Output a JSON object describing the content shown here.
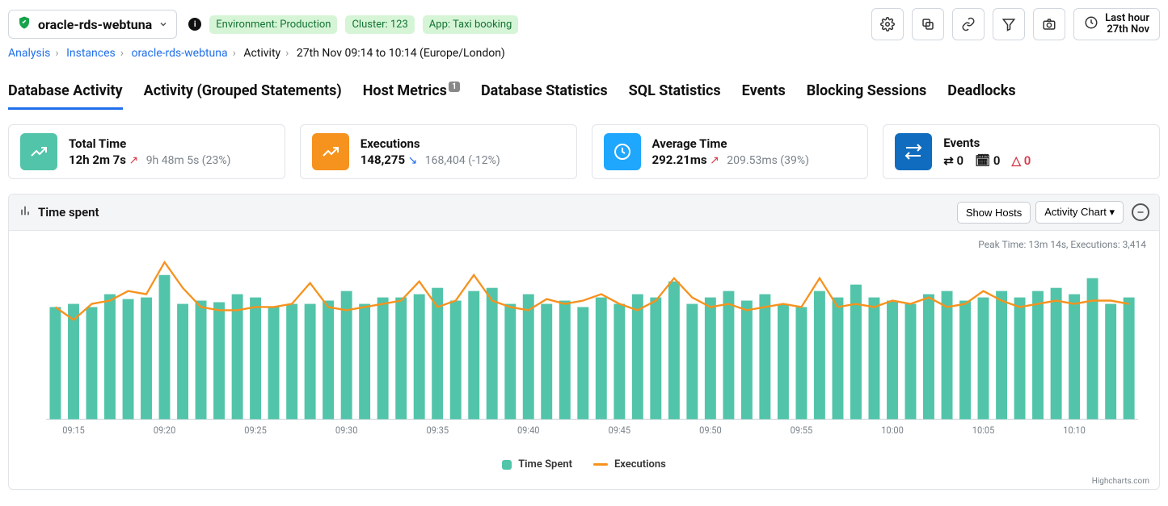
{
  "header": {
    "instance_name": "oracle-rds-webtuna",
    "env_pill": "Environment: Production",
    "cluster_pill": "Cluster: 123",
    "app_pill": "App: Taxi booking",
    "time_range_top": "Last hour",
    "time_range_bottom": "27th Nov"
  },
  "breadcrumbs": {
    "items": [
      "Analysis",
      "Instances",
      "oracle-rds-webtuna",
      "Activity",
      "27th Nov 09:14 to 10:14 (Europe/London)"
    ]
  },
  "tabs": [
    {
      "label": "Database Activity"
    },
    {
      "label": "Activity (Grouped Statements)"
    },
    {
      "label": "Host Metrics",
      "badge": "1"
    },
    {
      "label": "Database Statistics"
    },
    {
      "label": "SQL Statistics"
    },
    {
      "label": "Events"
    },
    {
      "label": "Blocking Sessions"
    },
    {
      "label": "Deadlocks"
    }
  ],
  "cards": {
    "total_time": {
      "title": "Total Time",
      "value": "12h 2m 7s",
      "trend": "up",
      "secondary": "9h 48m 5s (23%)"
    },
    "executions": {
      "title": "Executions",
      "value": "148,275",
      "trend": "down",
      "secondary": "168,404 (-12%)"
    },
    "avg_time": {
      "title": "Average Time",
      "value": "292.21ms",
      "trend": "up",
      "secondary": "209.53ms (39%)"
    },
    "events": {
      "title": "Events",
      "swap": "0",
      "cal": "0",
      "warn": "0"
    }
  },
  "panel": {
    "title": "Time spent",
    "btn_show_hosts": "Show Hosts",
    "btn_activity_chart": "Activity Chart",
    "peak": "Peak Time: 13m 14s, Executions: 3,414",
    "legend_time": "Time Spent",
    "legend_exec": "Executions",
    "credit": "Highcharts.com"
  },
  "chart_data": {
    "type": "bar+line",
    "x_labels": [
      "09:15",
      "09:20",
      "09:25",
      "09:30",
      "09:35",
      "09:40",
      "09:45",
      "09:50",
      "09:55",
      "10:00",
      "10:05",
      "10:10"
    ],
    "series": [
      {
        "name": "Time Spent",
        "type": "bar",
        "color": "#52c4a9",
        "values": [
          70,
          72,
          70,
          78,
          75,
          76,
          90,
          72,
          74,
          73,
          78,
          76,
          70,
          72,
          72,
          74,
          80,
          72,
          76,
          76,
          78,
          82,
          74,
          80,
          82,
          72,
          78,
          72,
          74,
          70,
          76,
          72,
          78,
          76,
          86,
          72,
          76,
          80,
          74,
          78,
          72,
          70,
          80,
          76,
          84,
          76,
          74,
          72,
          78,
          80,
          74,
          76,
          80,
          76,
          80,
          82,
          78,
          88,
          72,
          76
        ]
      },
      {
        "name": "Executions",
        "type": "line",
        "color": "#f6921e",
        "values": [
          70,
          62,
          72,
          74,
          80,
          78,
          98,
          82,
          70,
          68,
          68,
          70,
          70,
          72,
          85,
          70,
          68,
          70,
          72,
          74,
          86,
          70,
          74,
          90,
          74,
          70,
          68,
          75,
          72,
          74,
          78,
          72,
          68,
          74,
          88,
          76,
          70,
          72,
          68,
          70,
          72,
          70,
          88,
          70,
          72,
          70,
          74,
          72,
          76,
          70,
          72,
          80,
          74,
          70,
          72,
          74,
          72,
          74,
          74,
          72
        ]
      }
    ],
    "ylim": [
      0,
      100
    ],
    "y_unit": "relative",
    "note": "Values are approximate relative heights (0-100) read from an unlabeled y-axis; absolute units not shown."
  }
}
